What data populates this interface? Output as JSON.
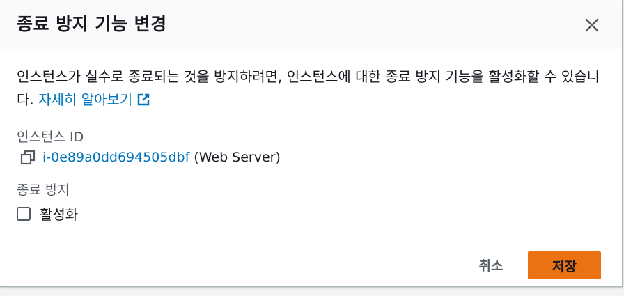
{
  "modal": {
    "title": "종료 방지 기능 변경",
    "close_icon": "close-icon"
  },
  "body": {
    "description": "인스턴스가 실수로 종료되는 것을 방지하려면, 인스턴스에 대한 종료 방지 기능을 활성화할 수 있습니다.",
    "learn_more_link": "자세히 알아보기",
    "external_link_icon": "external-link-icon",
    "instance_id_label": "인스턴스 ID",
    "copy_icon": "copy-icon",
    "instance_id": "i-0e89a0dd694505dbf",
    "instance_name": "(Web Server)",
    "termination_label": "종료 방지",
    "checkbox_label": "활성화",
    "checkbox_checked": false
  },
  "footer": {
    "cancel_label": "취소",
    "save_label": "저장"
  },
  "colors": {
    "link": "#0073bb",
    "primary_button": "#ec7211",
    "text": "#16191f",
    "muted_text": "#545b64"
  }
}
